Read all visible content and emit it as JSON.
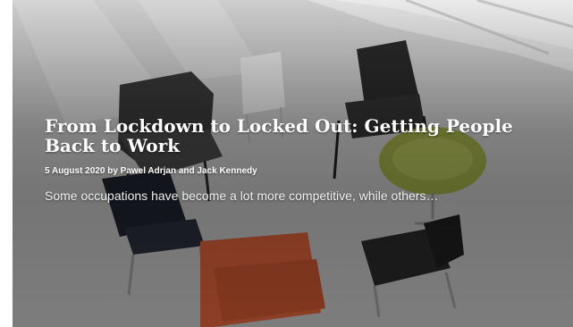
{
  "article": {
    "title": "From Lockdown to Locked Out: Getting People Back to Work",
    "byline": "5 August 2020 by Pawel Adrjan and Jack Kennedy",
    "excerpt": "Some occupations have become a lot more competitive, while others…"
  },
  "image": {
    "subject": "chairs-arranged-in-circle-photo"
  }
}
